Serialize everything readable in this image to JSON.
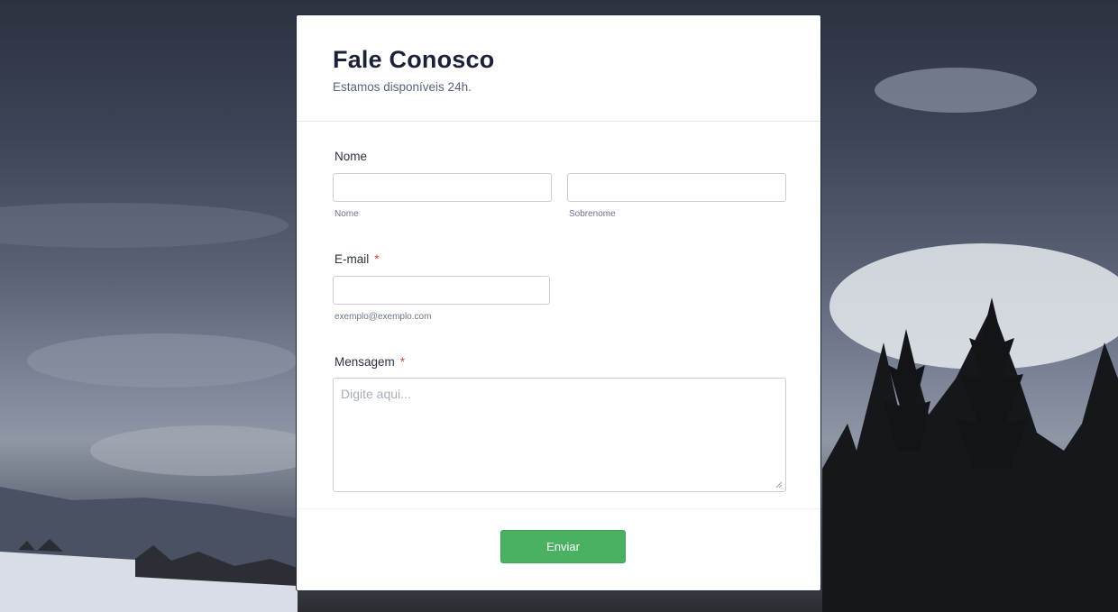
{
  "form": {
    "title": "Fale Conosco",
    "subtitle": "Estamos disponíveis 24h.",
    "name_field": {
      "label": "Nome",
      "first_value": "",
      "first_sublabel": "Nome",
      "last_value": "",
      "last_sublabel": "Sobrenome"
    },
    "email_field": {
      "label": "E-mail",
      "required_mark": "*",
      "value": "",
      "sublabel": "exemplo@exemplo.com"
    },
    "message_field": {
      "label": "Mensagem",
      "required_mark": "*",
      "value": "",
      "placeholder": "Digite aqui..."
    },
    "submit_label": "Enviar"
  },
  "colors": {
    "submit_button": "#4ab162",
    "required_mark": "#e0423b",
    "title_text": "#1b2238"
  }
}
